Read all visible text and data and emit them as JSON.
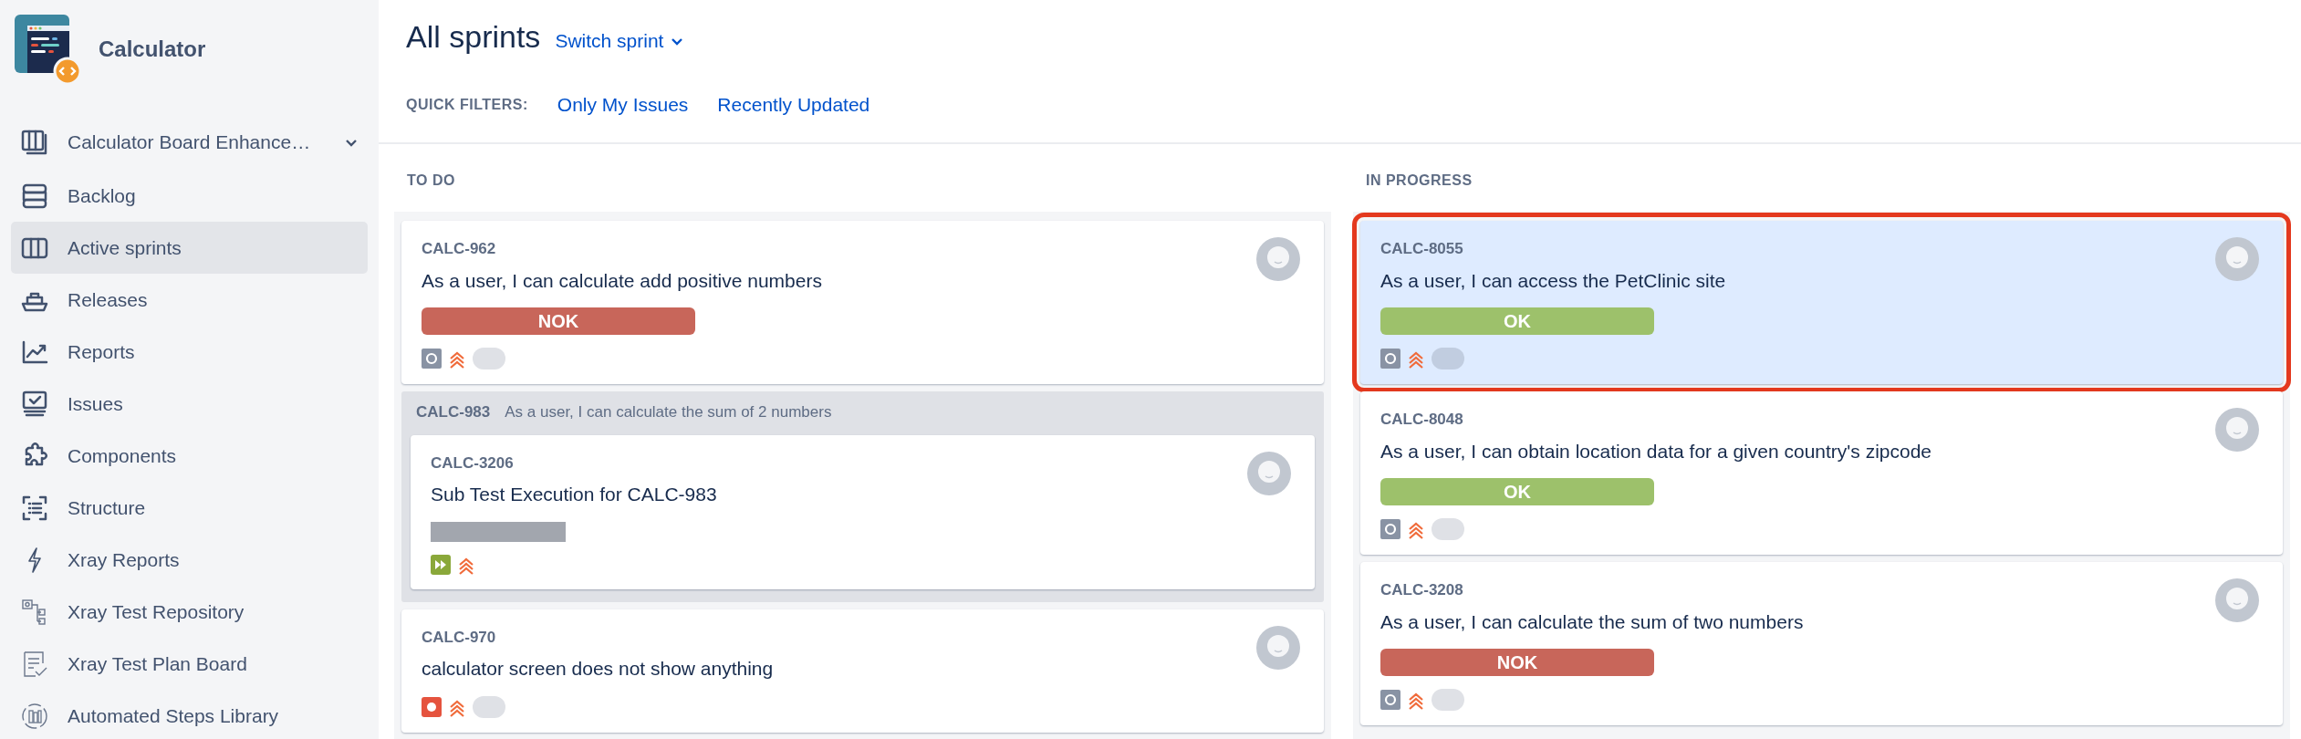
{
  "sidebar": {
    "project": "Calculator",
    "board": "Calculator Board Enhance…",
    "items": [
      {
        "label": "Backlog",
        "selected": false
      },
      {
        "label": "Active sprints",
        "selected": true
      },
      {
        "label": "Releases",
        "selected": false
      },
      {
        "label": "Reports",
        "selected": false
      },
      {
        "label": "Issues",
        "selected": false
      },
      {
        "label": "Components",
        "selected": false
      },
      {
        "label": "Structure",
        "selected": false
      },
      {
        "label": "Xray Reports",
        "selected": false
      },
      {
        "label": "Xray Test Repository",
        "selected": false
      },
      {
        "label": "Xray Test Plan Board",
        "selected": false
      },
      {
        "label": "Automated Steps Library",
        "selected": false
      }
    ]
  },
  "header": {
    "title": "All sprints",
    "switch": "Switch sprint",
    "filters_label": "QUICK FILTERS:",
    "filters": [
      "Only My Issues",
      "Recently Updated"
    ]
  },
  "columns": [
    {
      "title": "TO DO",
      "items": [
        {
          "kind": "test",
          "key": "CALC-962",
          "summary": "As a user, I can calculate add positive numbers",
          "status": {
            "label": "NOK",
            "color": "#c8665a"
          },
          "estimate": true,
          "selected": false
        },
        {
          "kind": "parent",
          "key": "CALC-983",
          "summary": "As a user, I can calculate the sum of 2 numbers",
          "children": [
            {
              "kind": "sub-test-execution",
              "key": "CALC-3206",
              "summary": "Sub Test Execution for CALC-983",
              "status": {
                "color": "#a2a6ae"
              },
              "estimate": false,
              "selected": false
            }
          ]
        },
        {
          "kind": "bug",
          "key": "CALC-970",
          "summary": "calculator screen does not show anything",
          "estimate": true,
          "selected": false
        }
      ]
    },
    {
      "title": "IN PROGRESS",
      "items": [
        {
          "kind": "test",
          "key": "CALC-8055",
          "summary": "As a user, I can access the PetClinic site",
          "status": {
            "label": "OK",
            "color": "#9dc16b"
          },
          "estimate": true,
          "selected": true
        },
        {
          "kind": "test",
          "key": "CALC-8048",
          "summary": "As a user, I can obtain location data for a given country's zipcode",
          "status": {
            "label": "OK",
            "color": "#9dc16b"
          },
          "estimate": true,
          "selected": false
        },
        {
          "kind": "test",
          "key": "CALC-3208",
          "summary": "As a user, I can calculate the sum of two numbers",
          "status": {
            "label": "NOK",
            "color": "#c8665a"
          },
          "estimate": true,
          "selected": false
        }
      ]
    }
  ]
}
